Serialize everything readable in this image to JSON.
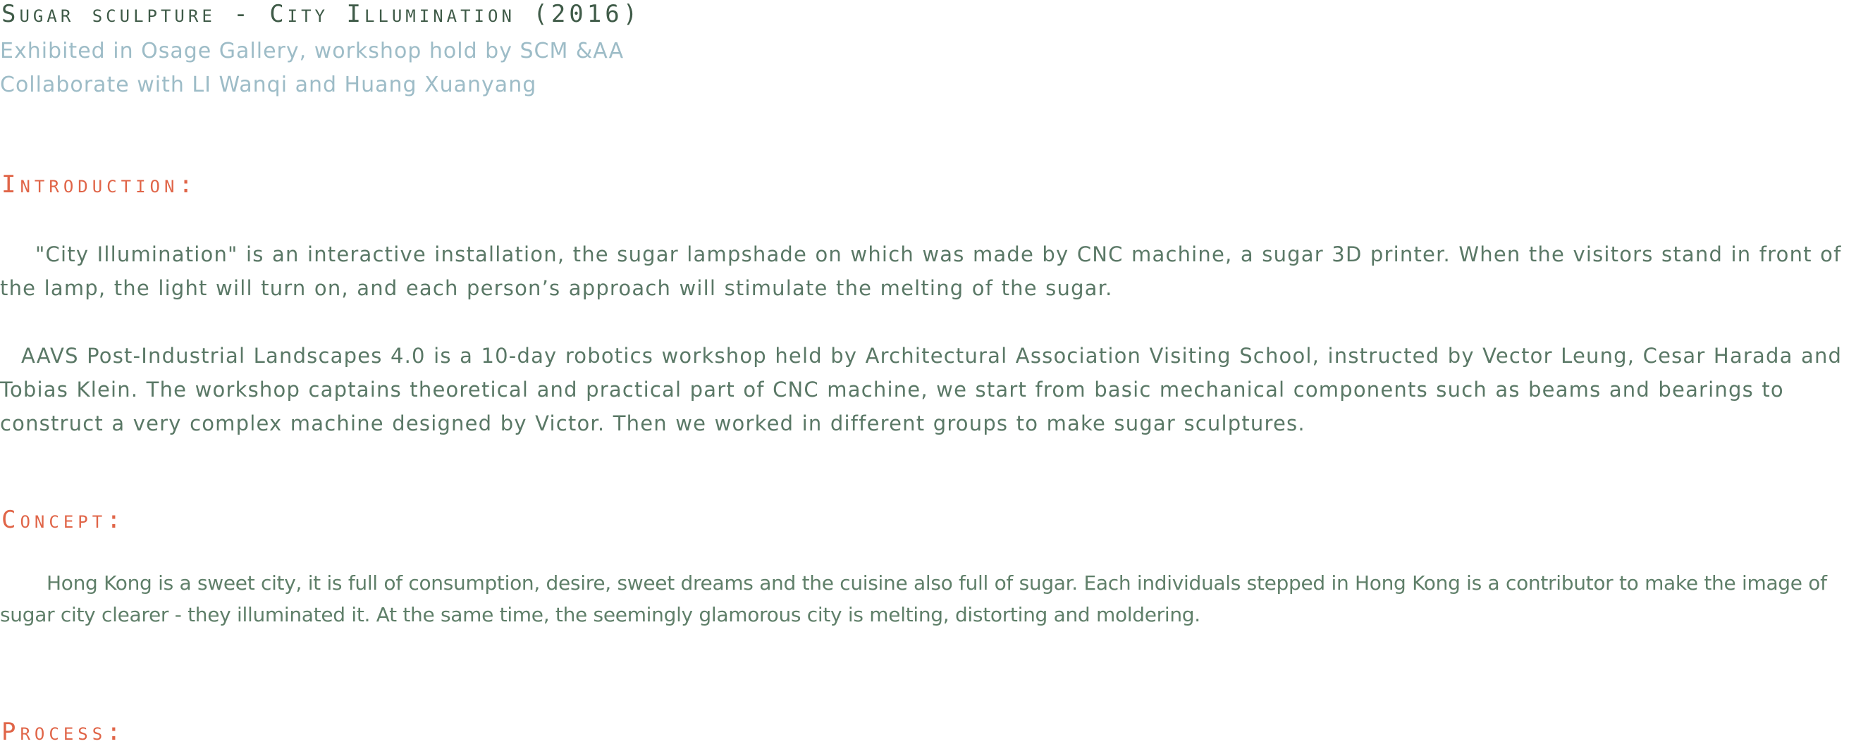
{
  "project": {
    "title": "Sugar sculpture - City Illumination (2016)",
    "meta_line_1": "Exhibited in Osage Gallery, workshop hold by SCM &AA",
    "meta_line_2": "Collaborate with LI Wanqi and Huang Xuanyang"
  },
  "sections": {
    "introduction": {
      "heading": "Introduction:",
      "paragraph_1": "\"City Illumination\" is an interactive installation, the sugar lampshade on which was made by CNC machine, a sugar 3D printer. When the visitors stand in front of the lamp, the light will turn on, and each person’s approach will stimulate the melting of the sugar.",
      "paragraph_2": "AAVS Post-Industrial Landscapes 4.0 is a 10-day robotics workshop held by Architectural Association Visiting School, instructed by Vector Leung, Cesar Harada and Tobias Klein. The workshop captains theoretical and practical part of CNC machine, we start from basic mechanical components such as beams and bearings to construct a very complex machine designed by Victor. Then we worked in different groups to make sugar sculptures."
    },
    "concept": {
      "heading": "Concept:",
      "paragraph": "Hong Kong is a sweet city, it is full of consumption, desire, sweet dreams and the cuisine also full of sugar. Each individuals stepped in Hong Kong is a contributor to make the image of sugar city clearer -  they illuminated it. At the same time,  the seemingly glamorous city is melting, distorting and  moldering."
    },
    "process": {
      "heading": "Process:"
    }
  },
  "colors": {
    "title": "#3f5b48",
    "meta": "#9dbcc7",
    "heading": "#e06548",
    "body": "#5a7866"
  }
}
